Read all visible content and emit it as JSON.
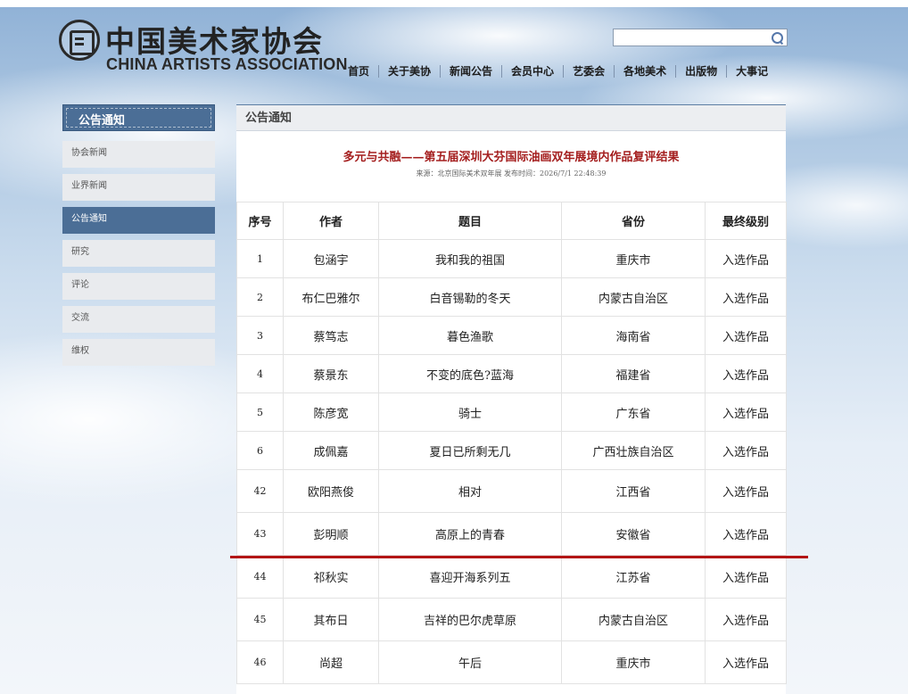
{
  "header": {
    "logo_cn": "中国美术家协会",
    "logo_en": "CHINA ARTISTS ASSOCIATION",
    "search_value": "",
    "nav": [
      "首页",
      "关于美协",
      "新闻公告",
      "会员中心",
      "艺委会",
      "各地美术",
      "出版物",
      "大事记"
    ]
  },
  "sidebar": {
    "title": "公告通知",
    "items": [
      {
        "label": "协会新闻",
        "active": false
      },
      {
        "label": "业界新闻",
        "active": false
      },
      {
        "label": "公告通知",
        "active": true
      },
      {
        "label": "研究",
        "active": false
      },
      {
        "label": "评论",
        "active": false
      },
      {
        "label": "交流",
        "active": false
      },
      {
        "label": "维权",
        "active": false
      }
    ]
  },
  "main": {
    "section_title": "公告通知",
    "article_title": "多元与共融——第五届深圳大芬国际油画双年展境内作品复评结果",
    "article_meta": "来源：北京国际美术双年展 发布时间：2026/7/1 22:48:39",
    "table": {
      "headers": [
        "序号",
        "作者",
        "题目",
        "省份",
        "最终级别"
      ],
      "rows": [
        [
          "1",
          "包涵宇",
          "我和我的祖国",
          "重庆市",
          "入选作品"
        ],
        [
          "2",
          "布仁巴雅尔",
          "白音锡勒的冬天",
          "内蒙古自治区",
          "入选作品"
        ],
        [
          "3",
          "蔡笃志",
          "暮色渔歌",
          "海南省",
          "入选作品"
        ],
        [
          "4",
          "蔡景东",
          "不变的底色?蓝海",
          "福建省",
          "入选作品"
        ],
        [
          "5",
          "陈彦宽",
          "骑士",
          "广东省",
          "入选作品"
        ],
        [
          "6",
          "成佩嘉",
          "夏日已所剩无几",
          "广西壮族自治区",
          "入选作品"
        ],
        [
          "42",
          "欧阳燕俊",
          "相对",
          "江西省",
          "入选作品"
        ],
        [
          "43",
          "彭明顺",
          "高原上的青春",
          "安徽省",
          "入选作品"
        ],
        [
          "44",
          "祁秋实",
          "喜迎开海系列五",
          "江苏省",
          "入选作品"
        ],
        [
          "45",
          "其布日",
          "吉祥的巴尔虎草原",
          "内蒙古自治区",
          "入选作品"
        ],
        [
          "46",
          "尚超",
          "午后",
          "重庆市",
          "入选作品"
        ]
      ]
    }
  },
  "colors": {
    "accent_blue": "#4b6e96",
    "title_red": "#a41e1e",
    "divider_red": "#b31515"
  }
}
